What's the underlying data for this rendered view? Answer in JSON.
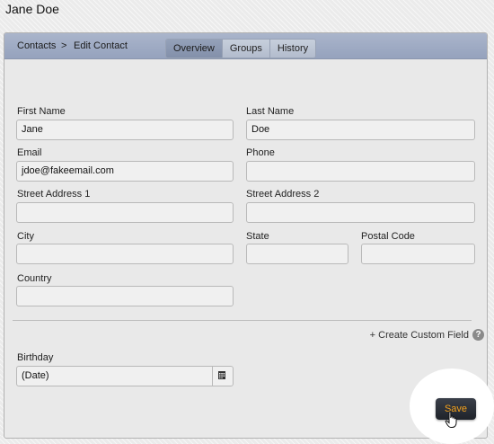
{
  "page": {
    "title": "Jane Doe"
  },
  "breadcrumb": {
    "parent": "Contacts",
    "separator": ">",
    "current": "Edit Contact"
  },
  "tabs": [
    {
      "label": "Overview",
      "active": true
    },
    {
      "label": "Groups",
      "active": false
    },
    {
      "label": "History",
      "active": false
    }
  ],
  "form": {
    "first_name": {
      "label": "First Name",
      "value": "Jane"
    },
    "last_name": {
      "label": "Last Name",
      "value": "Doe"
    },
    "email": {
      "label": "Email",
      "value": "jdoe@fakeemail.com"
    },
    "phone": {
      "label": "Phone",
      "value": ""
    },
    "street1": {
      "label": "Street Address 1",
      "value": ""
    },
    "street2": {
      "label": "Street Address 2",
      "value": ""
    },
    "city": {
      "label": "City",
      "value": ""
    },
    "state": {
      "label": "State",
      "value": ""
    },
    "postal": {
      "label": "Postal Code",
      "value": ""
    },
    "country": {
      "label": "Country",
      "value": ""
    },
    "birthday": {
      "label": "Birthday",
      "value": "(Date)"
    }
  },
  "custom_field_link": "+ Create Custom Field",
  "help_icon": "?",
  "save_label": "Save",
  "colors": {
    "header": "#9aa6c0",
    "save_bg": "#2a2e36",
    "save_text": "#f3a11d"
  }
}
